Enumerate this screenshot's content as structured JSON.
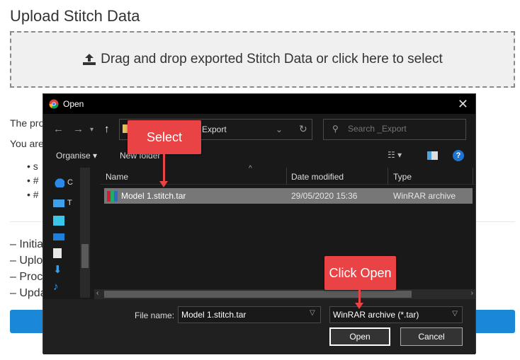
{
  "page": {
    "title": "Upload Stitch Data",
    "dropzone_text": "Drag and drop exported Stitch Data or click here to select",
    "partial_text_1": "The pro",
    "partial_text_2": "You are",
    "bullets": [
      "s",
      "#",
      "#"
    ],
    "steps": [
      "– Initia",
      "– Uplo",
      "– Proc",
      "– Upda"
    ]
  },
  "dialog": {
    "title": "Open",
    "address_path": "Export",
    "search_placeholder": "Search _Export",
    "toolbar": {
      "organise": "Organise ▾",
      "new_folder": "New folder"
    },
    "nav_items": [
      "C",
      "T"
    ],
    "columns": {
      "name": "Name",
      "date_modified": "Date modified",
      "type": "Type"
    },
    "files": [
      {
        "name": "Model 1.stitch.tar",
        "date": "29/05/2020 15:36",
        "type": "WinRAR archive"
      }
    ],
    "footer": {
      "file_name_label": "File name:",
      "file_name_value": "Model 1.stitch.tar",
      "file_type": "WinRAR archive (*.tar)",
      "open_label": "Open",
      "cancel_label": "Cancel"
    }
  },
  "callouts": {
    "select": "Select",
    "click_open": "Click Open"
  },
  "colors": {
    "callout": "#ea4346",
    "bg_button": "#1a88d6",
    "dialog_bg": "#191919"
  }
}
